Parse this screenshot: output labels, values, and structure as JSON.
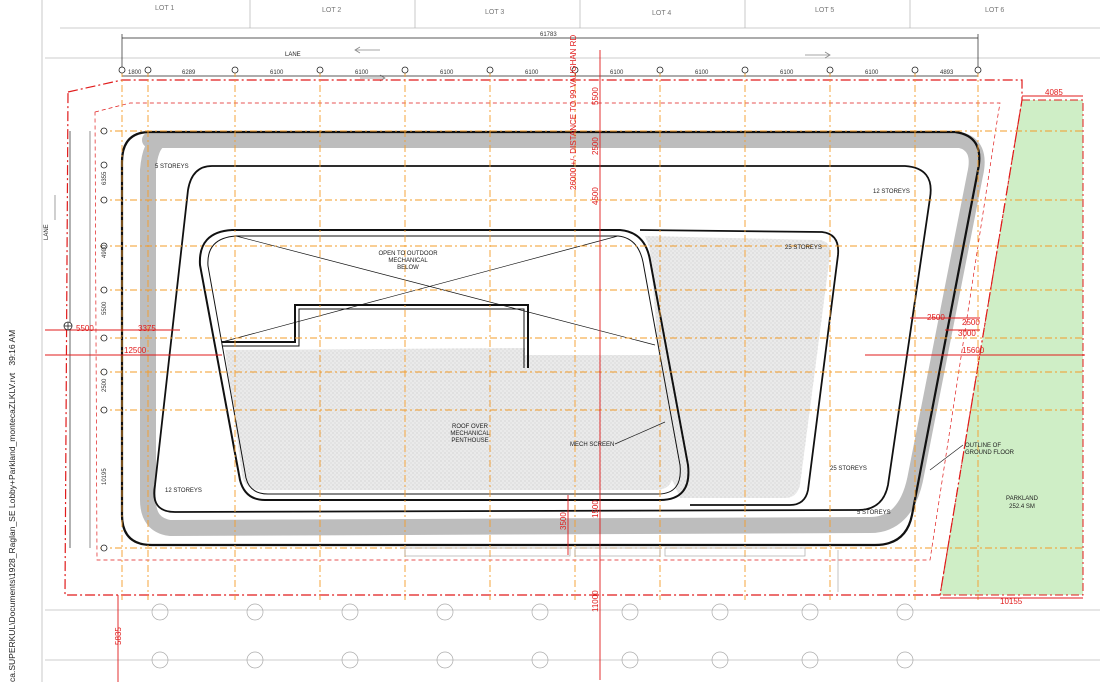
{
  "sheet": {
    "path_text": "ca.SUPERKUL\\Documents\\1928_Raglan_SE Lobby+Parkland_montecaZLKLV.rvt",
    "time_text": "39:16 AM"
  },
  "lots": [
    "LOT 1",
    "LOT 2",
    "LOT 3",
    "LOT 4",
    "LOT 5",
    "LOT 6"
  ],
  "lane_labels": {
    "top": "LANE",
    "left": "LANE"
  },
  "top_dimensions": {
    "overall": "61783",
    "segments": [
      "1800",
      "6289",
      "6100",
      "6100",
      "6100",
      "6100",
      "6100",
      "6100",
      "6100",
      "6100",
      "4893"
    ]
  },
  "left_dimensions": [
    "6355",
    "4900",
    "5500",
    "2500",
    "10195"
  ],
  "setback_labels": {
    "left_small": "5500",
    "left_3375": "3375",
    "left_12500": "12500",
    "right_15600": "15600",
    "right_2500a": "2500",
    "right_2500b": "2500",
    "right_3000": "3000",
    "top_right_4085": "4085",
    "bottom_right_10155": "10155",
    "bottom_left_5835": "5835"
  },
  "vertical_dims": {
    "distance_label": "26000 +/- DISTANCE TO 99 VAUGHAN RD",
    "d5500": "5500",
    "d2500": "2500",
    "d4500": "4500",
    "d11000": "11000",
    "d1500": "1500",
    "d3500": "3500"
  },
  "storey_labels": {
    "s5_top": "5 STOREYS",
    "s12_top": "12 STOREYS",
    "s25_top": "25 STOREYS",
    "s12_bottom": "12 STOREYS",
    "s25_bottom": "25 STOREYS",
    "s5_bottom": "5 STOREYS"
  },
  "annotations": {
    "open_to_outdoor": [
      "OPEN TO OUTDOOR",
      "MECHANICAL",
      "BELOW"
    ],
    "roof_over": [
      "ROOF OVER",
      "MECHANICAL",
      "PENTHOUSE"
    ],
    "mech_screen": "MECH SCREEN",
    "outline_ground": [
      "OUTLINE OF",
      "GROUND FLOOR"
    ],
    "parkland": [
      "PARKLAND",
      "252.4 SM"
    ]
  },
  "colors": {
    "grid_orange": "#f39c2a",
    "property_red": "#e01b1b",
    "parkland_green": "#cfeec6",
    "hatch_grey": "#c8c8c8"
  }
}
